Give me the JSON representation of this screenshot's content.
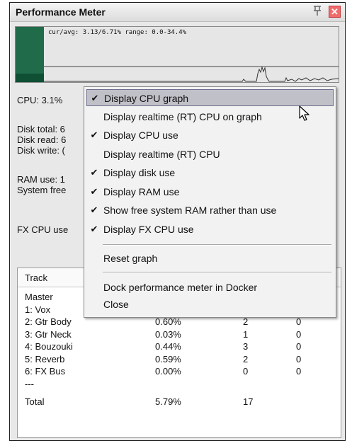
{
  "window": {
    "title": "Performance Meter"
  },
  "icons": {
    "pin": "pin-icon",
    "close": "close-icon",
    "check": "checkmark-icon",
    "cursor": "mouse-pointer-icon"
  },
  "graph": {
    "stats_text": "cur/avg: 3.13/6.71%  range: 0.0-34.4%"
  },
  "stats": {
    "cpu": "CPU: 3.1%",
    "disk_total": "Disk total: 6",
    "disk_read": "Disk read: 6",
    "disk_write": "Disk write: (",
    "ram_use": "RAM use: 1",
    "system_free": "System free",
    "fx_cpu": "FX CPU use"
  },
  "table": {
    "header_track": "Track",
    "rows": [
      {
        "track": "Master",
        "cpu": "",
        "a": "",
        "b": ""
      },
      {
        "track": "1: Vox",
        "cpu": "",
        "a": "",
        "b": ""
      },
      {
        "track": "2: Gtr Body",
        "cpu": "0.60%",
        "a": "2",
        "b": "0"
      },
      {
        "track": "3: Gtr Neck",
        "cpu": "0.03%",
        "a": "1",
        "b": "0"
      },
      {
        "track": "4: Bouzouki",
        "cpu": "0.44%",
        "a": "3",
        "b": "0"
      },
      {
        "track": "5: Reverb",
        "cpu": "0.59%",
        "a": "2",
        "b": "0"
      },
      {
        "track": "6: FX Bus",
        "cpu": "0.00%",
        "a": "0",
        "b": "0"
      },
      {
        "track": "---",
        "cpu": "",
        "a": "",
        "b": ""
      },
      {
        "track": "Total",
        "cpu": "5.79%",
        "a": "17",
        "b": ""
      }
    ]
  },
  "menu": {
    "items": [
      {
        "label": "Display CPU graph",
        "checked": true,
        "highlighted": true
      },
      {
        "label": "Display realtime (RT) CPU on graph",
        "checked": false
      },
      {
        "label": "Display CPU use",
        "checked": true
      },
      {
        "label": "Display realtime (RT) CPU",
        "checked": false
      },
      {
        "label": "Display disk use",
        "checked": true
      },
      {
        "label": "Display RAM use",
        "checked": true
      },
      {
        "label": "Show free system RAM rather than use",
        "checked": true
      },
      {
        "label": "Display FX CPU use",
        "checked": true
      }
    ],
    "reset": "Reset graph",
    "dock": "Dock performance meter in Docker",
    "close": "Close"
  }
}
